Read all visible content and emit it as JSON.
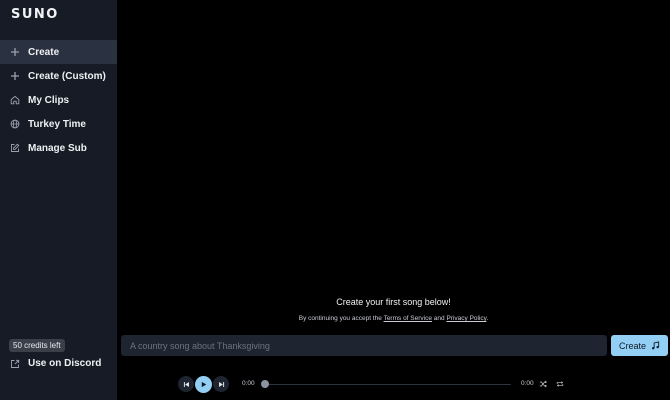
{
  "app": {
    "logo": "SUNO"
  },
  "sidebar": {
    "items": [
      {
        "label": "Create",
        "icon": "plus-icon",
        "active": true
      },
      {
        "label": "Create (Custom)",
        "icon": "plus-icon",
        "active": false
      },
      {
        "label": "My Clips",
        "icon": "home-icon",
        "active": false
      },
      {
        "label": "Turkey Time",
        "icon": "globe-icon",
        "active": false
      },
      {
        "label": "Manage Sub",
        "icon": "edit-icon",
        "active": false
      }
    ],
    "credits": "50 credits left",
    "discord_label": "Use on Discord",
    "discord_icon": "external-link-icon"
  },
  "main": {
    "headline": "Create your first song below!",
    "terms_prefix": "By continuing you accept the",
    "terms_link": "Terms of Service",
    "terms_and": "and",
    "privacy_link": "Privacy Policy",
    "terms_suffix": ".",
    "prompt_placeholder": "A country song about Thanksgiving",
    "create_label": "Create",
    "create_icon": "music-note-icon"
  },
  "player": {
    "current_time": "0:00",
    "duration": "0:00",
    "progress": 0
  },
  "colors": {
    "sidebar_bg": "#161b26",
    "main_bg": "#000000",
    "accent": "#93cef4",
    "active_item_bg": "#2a3140"
  }
}
